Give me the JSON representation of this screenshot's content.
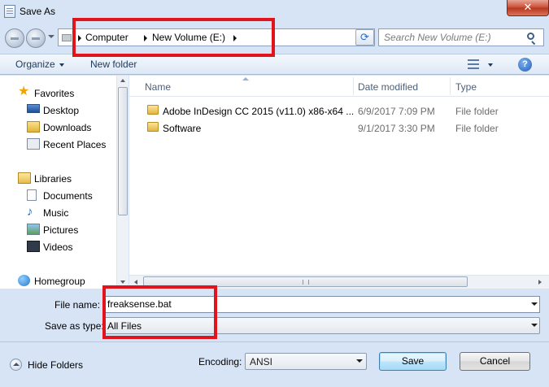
{
  "window": {
    "title": "Save As",
    "close_glyph": "✕"
  },
  "address": {
    "crumbs": [
      "Computer",
      "New Volume (E:)"
    ],
    "search_placeholder": "Search New Volume (E:)",
    "refresh_glyph": "⟳"
  },
  "toolbar": {
    "organize_label": "Organize",
    "new_folder_label": "New folder",
    "help_glyph": "?"
  },
  "nav": {
    "favorites": {
      "label": "Favorites",
      "items": [
        "Desktop",
        "Downloads",
        "Recent Places"
      ]
    },
    "libraries": {
      "label": "Libraries",
      "items": [
        "Documents",
        "Music",
        "Pictures",
        "Videos"
      ]
    },
    "homegroup": {
      "label": "Homegroup"
    }
  },
  "files": {
    "columns": {
      "name": "Name",
      "date": "Date modified",
      "type": "Type"
    },
    "rows": [
      {
        "name": "Adobe InDesign CC 2015 (v11.0) x86-x64 ...",
        "date": "6/9/2017 7:09 PM",
        "type": "File folder"
      },
      {
        "name": "Software",
        "date": "9/1/2017 3:30 PM",
        "type": "File folder"
      }
    ]
  },
  "form": {
    "filename_label": "File name:",
    "filename_value": "freaksense.bat",
    "savetype_label": "Save as type:",
    "savetype_value": "All Files",
    "encoding_label": "Encoding:",
    "encoding_value": "ANSI"
  },
  "footer": {
    "hide_folders_label": "Hide Folders",
    "save_label": "Save",
    "cancel_label": "Cancel"
  },
  "colors": {
    "annotation_red": "#e0141a",
    "dialog_bg": "#d6e4f5"
  }
}
